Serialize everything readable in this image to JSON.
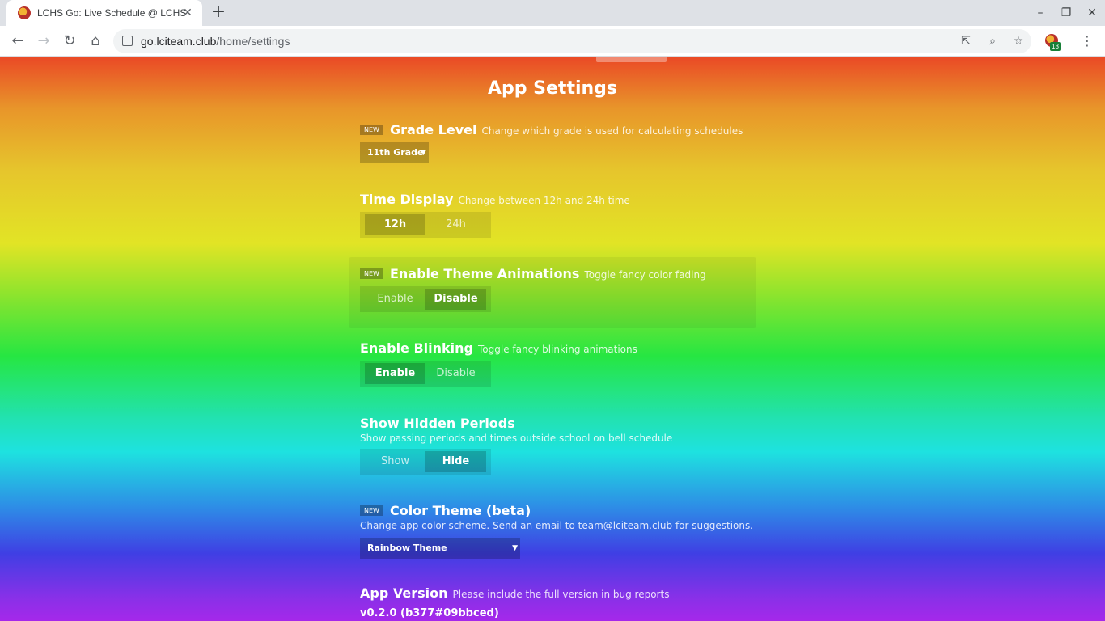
{
  "browser": {
    "tab_title": "LCHS Go: Live Schedule @ LCHS",
    "url_host": "go.lciteam.club",
    "url_path": "/home/settings",
    "extension_badge": "13"
  },
  "page": {
    "title": "App Settings",
    "new_badge": "NEW",
    "grade": {
      "title": "Grade Level",
      "desc": "Change which grade is used for calculating schedules",
      "value": "11th Grade"
    },
    "time_display": {
      "title": "Time Display",
      "desc": "Change between 12h and 24h time",
      "options": [
        "12h",
        "24h"
      ]
    },
    "theme_animations": {
      "title": "Enable Theme Animations",
      "desc": "Toggle fancy color fading",
      "options": [
        "Enable",
        "Disable"
      ]
    },
    "blinking": {
      "title": "Enable Blinking",
      "desc": "Toggle fancy blinking animations",
      "options": [
        "Enable",
        "Disable"
      ]
    },
    "hidden_periods": {
      "title": "Show Hidden Periods",
      "desc": "Show passing periods and times outside school on bell schedule",
      "options": [
        "Show",
        "Hide"
      ]
    },
    "color_theme": {
      "title": "Color Theme (beta)",
      "desc": "Change app color scheme. Send an email to team@lciteam.club for suggestions.",
      "value": "Rainbow Theme"
    },
    "app_version": {
      "title": "App Version",
      "desc": "Please include the full version in bug reports",
      "value": "v0.2.0 (b377#09bbced)"
    }
  }
}
